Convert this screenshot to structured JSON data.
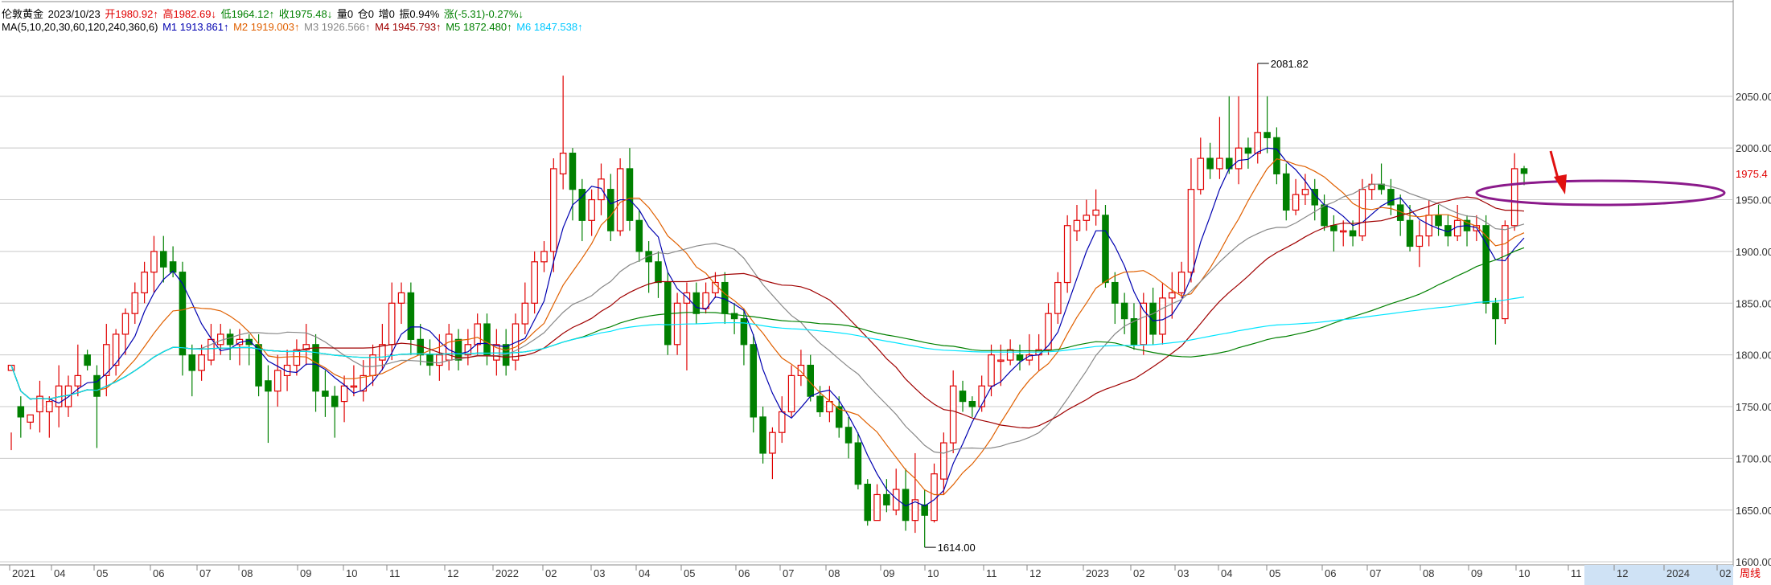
{
  "header": {
    "name": "伦敦黄金",
    "date": "2023/10/23",
    "open_label": "开1980.92↑",
    "high_label": "高1982.69↓",
    "low_label": "低1964.12↑",
    "close_label": "收1975.48↓",
    "vol_label": "量0",
    "pos_label": "仓0",
    "inc_label": "增0",
    "amp_label": "振0.94%",
    "chg_label": "涨(-5.31)-0.27%↓"
  },
  "ma_line": {
    "params": "MA(5,10,20,30,60,120,240,360,6)",
    "items": [
      {
        "label": "M1 1913.861↑",
        "color": "#0000b0"
      },
      {
        "label": "M2 1919.003↑",
        "color": "#e06000"
      },
      {
        "label": "M3 1926.566↑",
        "color": "#888888"
      },
      {
        "label": "M4 1945.793↑",
        "color": "#a00000"
      },
      {
        "label": "M5 1872.480↑",
        "color": "#008000"
      },
      {
        "label": "M6 1847.538↑",
        "color": "#00c8ff"
      }
    ]
  },
  "chart_data": {
    "type": "candlestick",
    "title": "伦敦黄金 weekly",
    "y_ticks": [
      1600,
      1650,
      1700,
      1750,
      1800,
      1850,
      1900,
      1950,
      2000,
      2050
    ],
    "ylim": [
      1597,
      2112
    ],
    "last_price_label": "1975.4",
    "annotations": [
      {
        "text": "2081.82",
        "value": 2081.82
      },
      {
        "text": "1614.00",
        "value": 1614.0
      }
    ],
    "x_tick_labels": [
      "2021",
      "04",
      "05",
      "06",
      "07",
      "08",
      "09",
      "10",
      "11",
      "12",
      "2022",
      "02",
      "03",
      "04",
      "05",
      "06",
      "07",
      "08",
      "09",
      "10",
      "11",
      "12",
      "2023",
      "02",
      "03",
      "04",
      "05",
      "06",
      "07",
      "08",
      "09",
      "10",
      "11",
      "12",
      "2024",
      "02"
    ],
    "period_label": "周线",
    "candles": [
      [
        1785,
        1790,
        1725,
        1708
      ],
      [
        1750,
        1740,
        1760,
        1720
      ],
      [
        1735,
        1742,
        1735,
        1728
      ],
      [
        1745,
        1760,
        1775,
        1725
      ],
      [
        1745,
        1755,
        1760,
        1720
      ],
      [
        1750,
        1770,
        1790,
        1730
      ],
      [
        1750,
        1770,
        1780,
        1740
      ],
      [
        1770,
        1780,
        1810,
        1760
      ],
      [
        1800,
        1790,
        1805,
        1785
      ],
      [
        1780,
        1760,
        1790,
        1710
      ],
      [
        1780,
        1810,
        1830,
        1760
      ],
      [
        1790,
        1820,
        1825,
        1780
      ],
      [
        1820,
        1840,
        1845,
        1800
      ],
      [
        1840,
        1860,
        1870,
        1830
      ],
      [
        1860,
        1880,
        1890,
        1850
      ],
      [
        1880,
        1900,
        1915,
        1860
      ],
      [
        1900,
        1885,
        1915,
        1870
      ],
      [
        1890,
        1880,
        1905,
        1875
      ],
      [
        1880,
        1800,
        1890,
        1780
      ],
      [
        1800,
        1785,
        1810,
        1760
      ],
      [
        1785,
        1800,
        1810,
        1775
      ],
      [
        1795,
        1815,
        1830,
        1790
      ],
      [
        1810,
        1820,
        1830,
        1800
      ],
      [
        1820,
        1810,
        1825,
        1795
      ],
      [
        1810,
        1815,
        1825,
        1790
      ],
      [
        1815,
        1810,
        1820,
        1790
      ],
      [
        1810,
        1770,
        1820,
        1760
      ],
      [
        1775,
        1765,
        1790,
        1715
      ],
      [
        1765,
        1785,
        1800,
        1750
      ],
      [
        1780,
        1790,
        1805,
        1765
      ],
      [
        1790,
        1805,
        1815,
        1780
      ],
      [
        1805,
        1810,
        1830,
        1790
      ],
      [
        1810,
        1765,
        1820,
        1745
      ],
      [
        1765,
        1760,
        1785,
        1740
      ],
      [
        1760,
        1750,
        1770,
        1720
      ],
      [
        1755,
        1770,
        1780,
        1735
      ],
      [
        1770,
        1770,
        1790,
        1760
      ],
      [
        1765,
        1780,
        1795,
        1755
      ],
      [
        1780,
        1800,
        1810,
        1770
      ],
      [
        1795,
        1810,
        1830,
        1785
      ],
      [
        1810,
        1850,
        1870,
        1795
      ],
      [
        1850,
        1860,
        1870,
        1830
      ],
      [
        1860,
        1815,
        1870,
        1800
      ],
      [
        1815,
        1800,
        1830,
        1790
      ],
      [
        1800,
        1790,
        1815,
        1780
      ],
      [
        1790,
        1800,
        1820,
        1775
      ],
      [
        1795,
        1820,
        1830,
        1785
      ],
      [
        1815,
        1795,
        1825,
        1785
      ],
      [
        1800,
        1810,
        1825,
        1790
      ],
      [
        1810,
        1830,
        1840,
        1800
      ],
      [
        1830,
        1800,
        1840,
        1790
      ],
      [
        1795,
        1810,
        1825,
        1780
      ],
      [
        1810,
        1790,
        1825,
        1780
      ],
      [
        1795,
        1830,
        1840,
        1785
      ],
      [
        1830,
        1850,
        1870,
        1820
      ],
      [
        1850,
        1890,
        1900,
        1840
      ],
      [
        1890,
        1900,
        1910,
        1880
      ],
      [
        1900,
        1980,
        1990,
        1880
      ],
      [
        1975,
        1995,
        2070,
        1960
      ],
      [
        1995,
        1960,
        2000,
        1930
      ],
      [
        1960,
        1930,
        1970,
        1910
      ],
      [
        1930,
        1950,
        1960,
        1915
      ],
      [
        1950,
        1970,
        1985,
        1935
      ],
      [
        1960,
        1920,
        1975,
        1910
      ],
      [
        1920,
        1980,
        1990,
        1915
      ],
      [
        1980,
        1930,
        2000,
        1920
      ],
      [
        1930,
        1900,
        1940,
        1890
      ],
      [
        1900,
        1890,
        1910,
        1860
      ],
      [
        1890,
        1870,
        1900,
        1855
      ],
      [
        1870,
        1810,
        1880,
        1800
      ],
      [
        1810,
        1850,
        1860,
        1800
      ],
      [
        1850,
        1860,
        1870,
        1785
      ],
      [
        1860,
        1840,
        1870,
        1830
      ],
      [
        1845,
        1860,
        1870,
        1840
      ],
      [
        1860,
        1870,
        1880,
        1855
      ],
      [
        1870,
        1840,
        1880,
        1830
      ],
      [
        1840,
        1835,
        1850,
        1820
      ],
      [
        1835,
        1810,
        1845,
        1790
      ],
      [
        1810,
        1740,
        1820,
        1725
      ],
      [
        1740,
        1705,
        1750,
        1695
      ],
      [
        1705,
        1725,
        1730,
        1680
      ],
      [
        1725,
        1745,
        1760,
        1715
      ],
      [
        1745,
        1780,
        1790,
        1740
      ],
      [
        1780,
        1790,
        1805,
        1770
      ],
      [
        1790,
        1760,
        1800,
        1755
      ],
      [
        1760,
        1745,
        1770,
        1740
      ],
      [
        1745,
        1755,
        1770,
        1735
      ],
      [
        1750,
        1730,
        1760,
        1720
      ],
      [
        1730,
        1715,
        1740,
        1700
      ],
      [
        1715,
        1675,
        1725,
        1670
      ],
      [
        1675,
        1640,
        1680,
        1635
      ],
      [
        1640,
        1665,
        1675,
        1640
      ],
      [
        1665,
        1655,
        1680,
        1648
      ],
      [
        1650,
        1670,
        1690,
        1645
      ],
      [
        1670,
        1640,
        1690,
        1630
      ],
      [
        1640,
        1660,
        1705,
        1628
      ],
      [
        1655,
        1645,
        1670,
        1614
      ],
      [
        1640,
        1685,
        1695,
        1638
      ],
      [
        1680,
        1715,
        1725,
        1665
      ],
      [
        1715,
        1770,
        1785,
        1705
      ],
      [
        1765,
        1755,
        1775,
        1745
      ],
      [
        1755,
        1750,
        1760,
        1740
      ],
      [
        1750,
        1770,
        1780,
        1745
      ],
      [
        1770,
        1800,
        1810,
        1760
      ],
      [
        1795,
        1795,
        1810,
        1770
      ],
      [
        1795,
        1805,
        1815,
        1790
      ],
      [
        1800,
        1795,
        1810,
        1785
      ],
      [
        1795,
        1800,
        1820,
        1790
      ],
      [
        1800,
        1805,
        1820,
        1785
      ],
      [
        1805,
        1840,
        1850,
        1800
      ],
      [
        1840,
        1870,
        1880,
        1830
      ],
      [
        1870,
        1925,
        1935,
        1860
      ],
      [
        1920,
        1930,
        1945,
        1910
      ],
      [
        1930,
        1935,
        1950,
        1920
      ],
      [
        1935,
        1940,
        1960,
        1925
      ],
      [
        1935,
        1870,
        1945,
        1865
      ],
      [
        1870,
        1850,
        1880,
        1830
      ],
      [
        1850,
        1835,
        1860,
        1820
      ],
      [
        1835,
        1810,
        1850,
        1805
      ],
      [
        1810,
        1850,
        1860,
        1800
      ],
      [
        1850,
        1820,
        1865,
        1810
      ],
      [
        1820,
        1855,
        1870,
        1810
      ],
      [
        1855,
        1860,
        1880,
        1835
      ],
      [
        1860,
        1880,
        1890,
        1855
      ],
      [
        1880,
        1960,
        1990,
        1870
      ],
      [
        1960,
        1990,
        2010,
        1955
      ],
      [
        1990,
        1980,
        2005,
        1970
      ],
      [
        1980,
        1990,
        2030,
        1970
      ],
      [
        1990,
        1980,
        2050,
        1975
      ],
      [
        1980,
        2000,
        2050,
        1965
      ],
      [
        2000,
        1995,
        2010,
        1980
      ],
      [
        1995,
        2015,
        2081.82,
        1985
      ],
      [
        2015,
        2010,
        2050,
        1995
      ],
      [
        2010,
        1975,
        2020,
        1965
      ],
      [
        1975,
        1940,
        1985,
        1930
      ],
      [
        1940,
        1955,
        1970,
        1935
      ],
      [
        1955,
        1960,
        1975,
        1945
      ],
      [
        1960,
        1945,
        1970,
        1930
      ],
      [
        1945,
        1925,
        1955,
        1920
      ],
      [
        1925,
        1920,
        1935,
        1900
      ],
      [
        1920,
        1920,
        1930,
        1905
      ],
      [
        1920,
        1915,
        1930,
        1905
      ],
      [
        1915,
        1960,
        1970,
        1910
      ],
      [
        1960,
        1965,
        1975,
        1950
      ],
      [
        1965,
        1960,
        1985,
        1955
      ],
      [
        1960,
        1945,
        1970,
        1935
      ],
      [
        1945,
        1930,
        1955,
        1915
      ],
      [
        1930,
        1905,
        1945,
        1900
      ],
      [
        1905,
        1915,
        1930,
        1885
      ],
      [
        1915,
        1935,
        1950,
        1905
      ],
      [
        1935,
        1925,
        1945,
        1915
      ],
      [
        1925,
        1915,
        1935,
        1905
      ],
      [
        1915,
        1930,
        1945,
        1910
      ],
      [
        1930,
        1920,
        1935,
        1905
      ],
      [
        1920,
        1925,
        1935,
        1910
      ],
      [
        1925,
        1850,
        1935,
        1840
      ],
      [
        1850,
        1835,
        1855,
        1810
      ],
      [
        1835,
        1925,
        1930,
        1830
      ],
      [
        1925,
        1980,
        1995,
        1920
      ],
      [
        1980,
        1975.48,
        1982.69,
        1964.12
      ]
    ]
  }
}
